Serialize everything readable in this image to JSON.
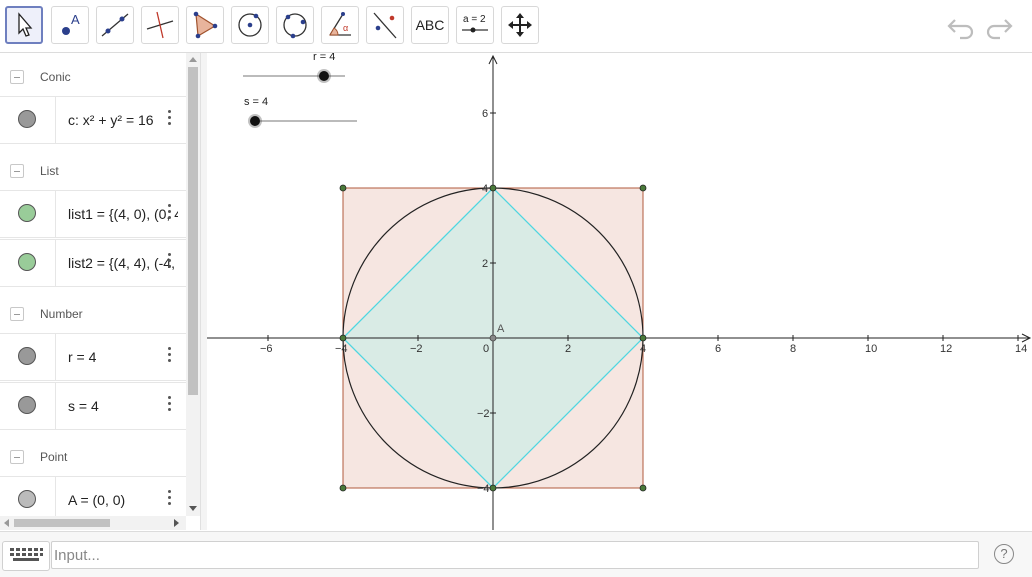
{
  "toolbar": {
    "tools": [
      {
        "name": "move-tool"
      },
      {
        "name": "point-tool",
        "label": "A"
      },
      {
        "name": "line-tool"
      },
      {
        "name": "perpendicular-line-tool"
      },
      {
        "name": "polygon-tool"
      },
      {
        "name": "circle-center-point-tool"
      },
      {
        "name": "circle-three-points-tool"
      },
      {
        "name": "angle-tool",
        "label": "α"
      },
      {
        "name": "reflect-tool"
      },
      {
        "name": "text-tool",
        "label": "ABC"
      },
      {
        "name": "slider-tool",
        "label": "a = 2"
      },
      {
        "name": "move-graphics-tool"
      }
    ]
  },
  "algebra": {
    "sections": [
      "Conic",
      "List",
      "Number",
      "Point"
    ],
    "items": [
      {
        "expr": "c: x² + y² = 16",
        "color": "#999999"
      },
      {
        "expr": "list1 = {(4, 0), (0, 4",
        "color": "#99cc99"
      },
      {
        "expr": "list2 = {(4, 4), (-4, 4",
        "color": "#99cc99"
      },
      {
        "expr": "r = 4",
        "color": "#999999"
      },
      {
        "expr": "s = 4",
        "color": "#999999"
      },
      {
        "expr": "A = (0, 0)",
        "color": "#999999"
      }
    ]
  },
  "sliders": {
    "r_label": "r = 4",
    "s_label": "s = 4"
  },
  "graph": {
    "x_ticks": [
      "−6",
      "−4",
      "−2",
      "0",
      "2",
      "4",
      "6",
      "8",
      "10",
      "12",
      "14"
    ],
    "y_ticks": [
      "6",
      "4",
      "2",
      "−2",
      "−4"
    ],
    "point_label": "A",
    "x_range": [
      -7.5,
      14.5
    ],
    "y_range": [
      -5,
      7.5
    ]
  },
  "input": {
    "placeholder": "Input...",
    "help": "?"
  },
  "colors": {
    "square_fill": "#f6e6e1",
    "square_stroke": "#b0593c",
    "diamond_fill": "#d9ebe5",
    "diamond_stroke": "#4fd6e0",
    "circle_stroke": "#222222"
  }
}
